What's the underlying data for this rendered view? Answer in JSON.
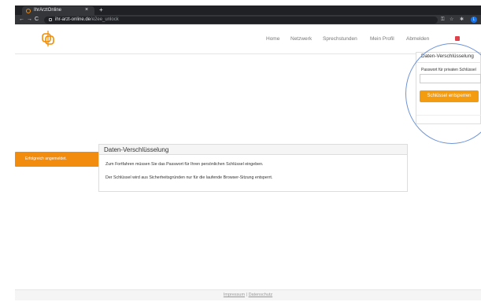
{
  "browser": {
    "tab_title": "IhrArztOnline",
    "tab_close": "×",
    "new_tab": "+",
    "back": "←",
    "forward": "→",
    "reload": "C",
    "url_host": "ihr-arzt-online.de",
    "url_path": "/e2ee_unlock",
    "key_icon": "⚿",
    "star_icon": "☆",
    "ext_icon": "✱",
    "profile_initial": "L",
    "colors": {
      "tabbar": "#202124",
      "toolbar": "#35363a"
    }
  },
  "header": {
    "nav": [
      "Home",
      "Netzwerk",
      "Sprechstunden",
      "Mein Profil",
      "Abmelden"
    ]
  },
  "dropdown": {
    "title": "Daten-Verschlüsselung",
    "password_label": "Passwort für privaten Schlüssel",
    "unlock_button": "Schlüssel entsperren"
  },
  "toast": {
    "message": "Erfolgreich angemeldet."
  },
  "card": {
    "title": "Daten-Verschlüsselung",
    "line1": "Zum Fortfahren müssen Sie das Passwort für Ihren persönlichen Schlüssel eingeben.",
    "line2": "Der Schlüssel wird aus Sicherheitsgründen nur für die laufende Browser-Sitzung entsperrt."
  },
  "footer": {
    "impressum": "Impressum",
    "separator": "|",
    "datenschutz": "Datenschutz"
  },
  "colors": {
    "accent": "#f39c12",
    "toast": "#f28c0f",
    "highlight": "#6f95d8"
  }
}
